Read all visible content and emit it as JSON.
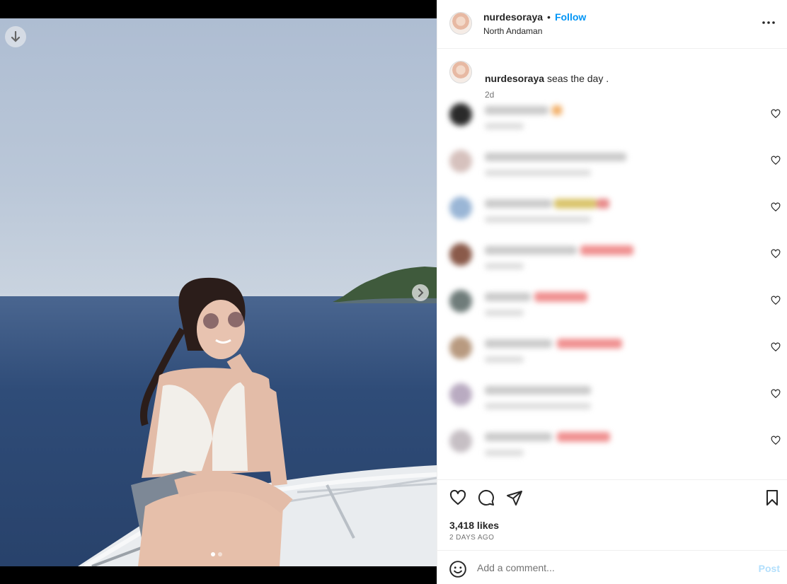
{
  "post": {
    "username": "nurdesoraya",
    "separator": "•",
    "follow_label": "Follow",
    "location": "North Andaman",
    "caption_username": "nurdesoraya",
    "caption": "seas the day .",
    "caption_time": "2d",
    "likes": "3,418 likes",
    "posted_ago": "2 DAYS AGO"
  },
  "media": {
    "carousel_count": 2,
    "carousel_active": 1
  },
  "comment_box": {
    "placeholder": "Add a comment...",
    "post_label": "Post"
  },
  "icons": {
    "download": "download-arrow-icon",
    "next": "chevron-right-icon",
    "more": "more-horizontal-icon",
    "like": "heart-icon",
    "comment": "comment-bubble-icon",
    "share": "paper-plane-icon",
    "save": "bookmark-icon",
    "emoji": "smiley-icon"
  },
  "colors": {
    "accent": "#0095f6",
    "post_disabled": "#b2dffc"
  }
}
